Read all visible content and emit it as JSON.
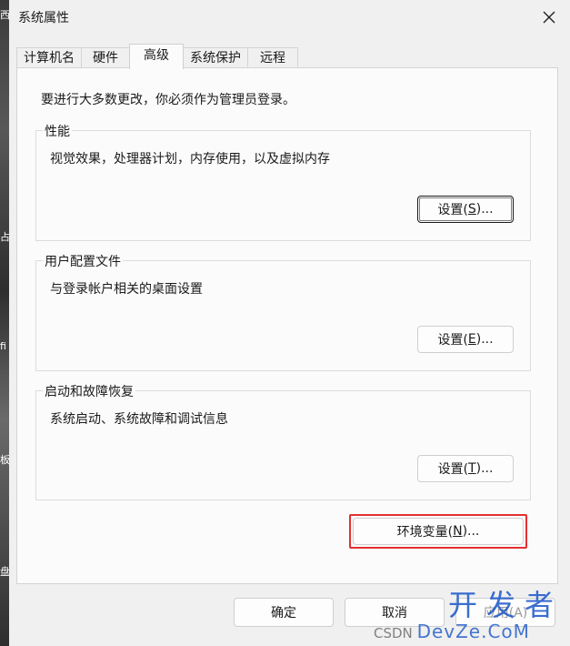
{
  "window": {
    "title": "系统属性"
  },
  "tabs": [
    {
      "label": "计算机名",
      "active": false
    },
    {
      "label": "硬件",
      "active": false
    },
    {
      "label": "高级",
      "active": true
    },
    {
      "label": "系统保护",
      "active": false
    },
    {
      "label": "远程",
      "active": false
    }
  ],
  "admin_note": "要进行大多数更改，你必须作为管理员登录。",
  "groups": {
    "performance": {
      "label": "性能",
      "description": "视觉效果，处理器计划，内存使用，以及虚拟内存",
      "button_prefix": "设置(",
      "button_key": "S",
      "button_suffix": ")..."
    },
    "user_profiles": {
      "label": "用户配置文件",
      "description": "与登录帐户相关的桌面设置",
      "button_prefix": "设置(",
      "button_key": "E",
      "button_suffix": ")..."
    },
    "startup_recovery": {
      "label": "启动和故障恢复",
      "description": "系统启动、系统故障和调试信息",
      "button_prefix": "设置(",
      "button_key": "T",
      "button_suffix": ")..."
    }
  },
  "env_button": {
    "prefix": "环境变量(",
    "key": "N",
    "suffix": ")..."
  },
  "footer": {
    "ok_label": "确定",
    "cancel_label": "取消",
    "apply_label": "应用(A)"
  },
  "watermark": {
    "big_text": "开发者",
    "small_prefix": "CSDN",
    "small_brand": "DevZe.CoM"
  },
  "desktop_strip": {
    "glyphs": [
      "西",
      "占",
      "fi",
      "板",
      "盘"
    ]
  },
  "colors": {
    "highlight": "#e53030",
    "watermark": "#1a56c8"
  }
}
